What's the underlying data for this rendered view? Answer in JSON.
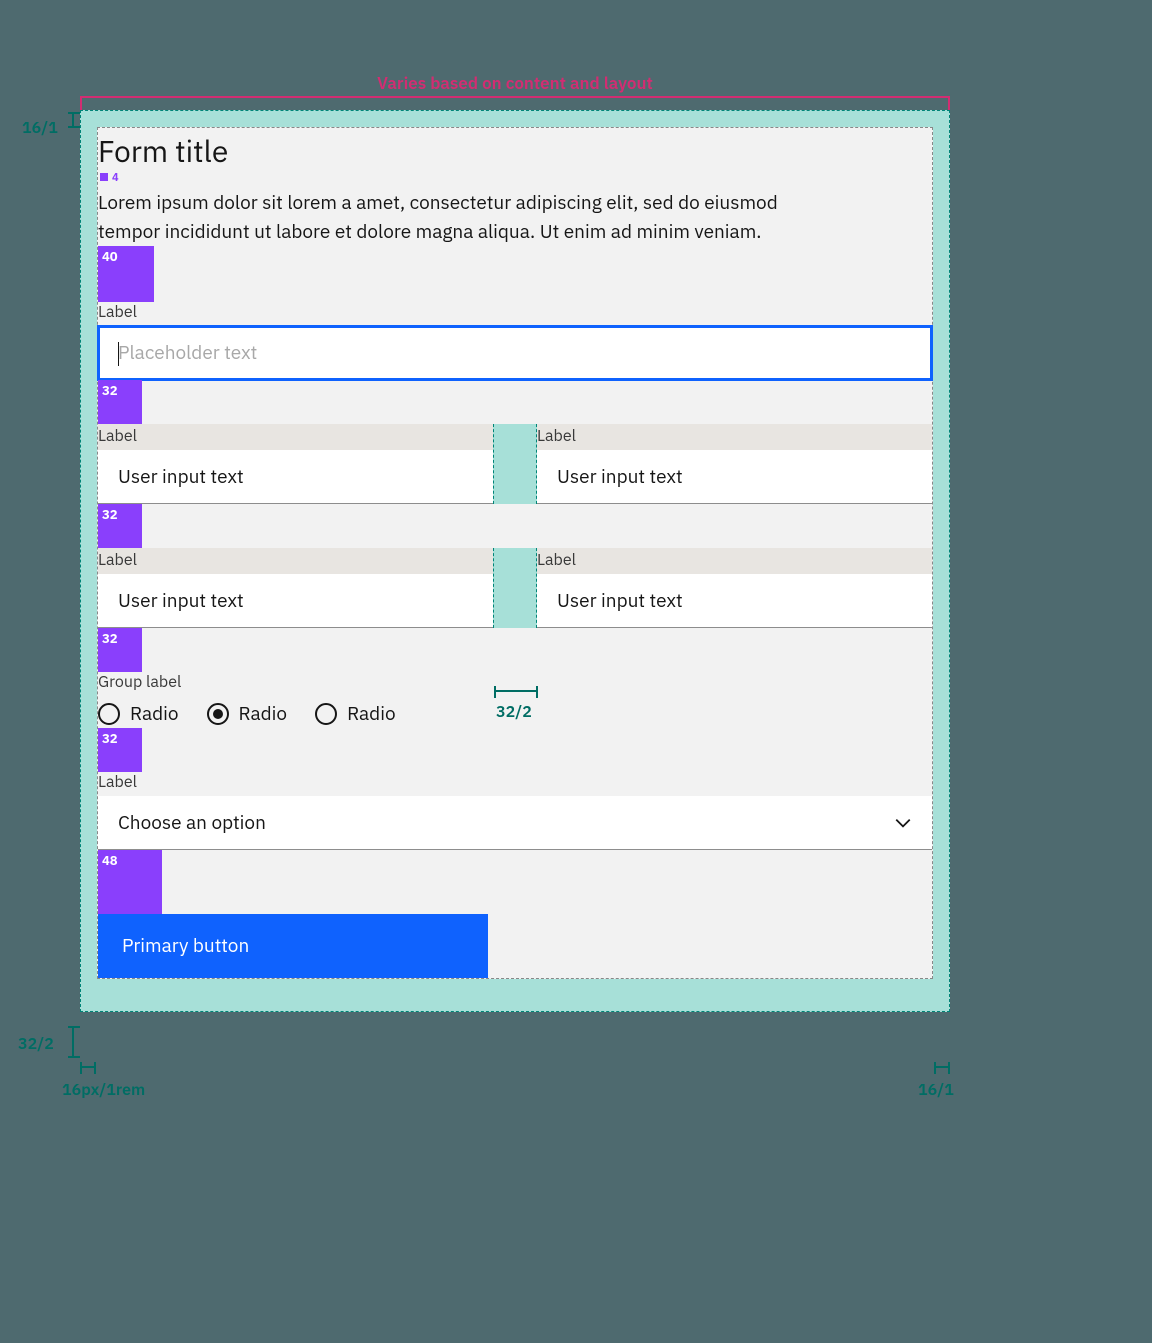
{
  "annotations": {
    "top": "Varies based on content and layout",
    "left_top_pad": "16/1",
    "left_bottom_pad": "32/2",
    "bottom_left": "16px/1rem",
    "bottom_right": "16/1",
    "gutter": "32/2"
  },
  "form": {
    "title": "Form title",
    "title_spacer": "4",
    "description": "Lorem ipsum dolor sit lorem a amet, consectetur adipiscing elit, sed do eiusmod tempor incididunt ut labore et dolore magna aliqua. Ut enim ad minim veniam.",
    "spacers": {
      "after_desc": "40",
      "after_row1": "32",
      "after_row2": "32",
      "after_row3": "32",
      "after_radio": "32",
      "after_select": "48"
    },
    "row1": {
      "label": "Label",
      "placeholder": "Placeholder text",
      "value": ""
    },
    "row2": {
      "left": {
        "label": "Label",
        "value": "User input text"
      },
      "right": {
        "label": "Label",
        "value": "User input text"
      }
    },
    "row3": {
      "left": {
        "label": "Label",
        "value": "User input text"
      },
      "right": {
        "label": "Label",
        "value": "User input text"
      }
    },
    "radio": {
      "group_label": "Group label",
      "options": [
        {
          "label": "Radio",
          "checked": false
        },
        {
          "label": "Radio",
          "checked": true
        },
        {
          "label": "Radio",
          "checked": false
        }
      ]
    },
    "select": {
      "label": "Label",
      "value": "Choose an option"
    },
    "button": {
      "label": "Primary button"
    }
  }
}
